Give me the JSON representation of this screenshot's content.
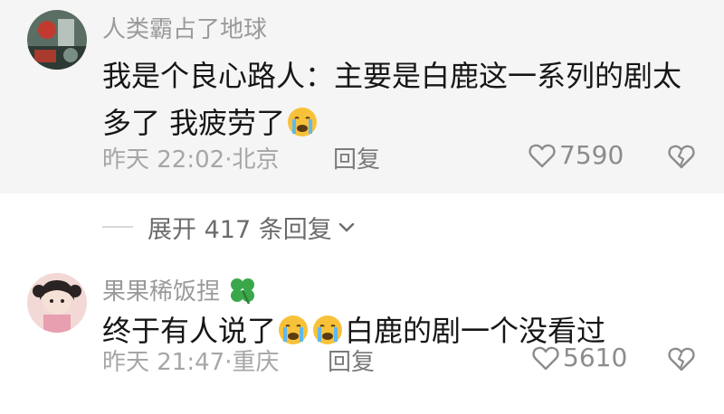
{
  "comments": [
    {
      "username": "人类霸占了地球",
      "text_main": "我是个良心路人：主要是白鹿这一系列的剧太多了 我疲劳了",
      "text_emoji": "crying-face-icon",
      "meta": "昨天 22:02·北京",
      "reply_label": "回复",
      "likes": "7590"
    },
    {
      "username": "果果稀饭捏",
      "username_badge": "four-leaf-clover-icon",
      "text_before": "终于有人说了",
      "text_emojis": [
        "crying-face-icon",
        "crying-face-icon"
      ],
      "text_after": "白鹿的剧一个没看过",
      "meta": "昨天 21:47·重庆",
      "reply_label": "回复",
      "likes": "5610"
    }
  ],
  "expand_replies": {
    "label": "展开 417 条回复"
  },
  "colors": {
    "highlight_bg": "#f5f5f5",
    "text_primary": "#161616",
    "text_secondary": "#9a9a9a",
    "emoji_face": "#f7c23a",
    "clover": "#3aa84a"
  }
}
